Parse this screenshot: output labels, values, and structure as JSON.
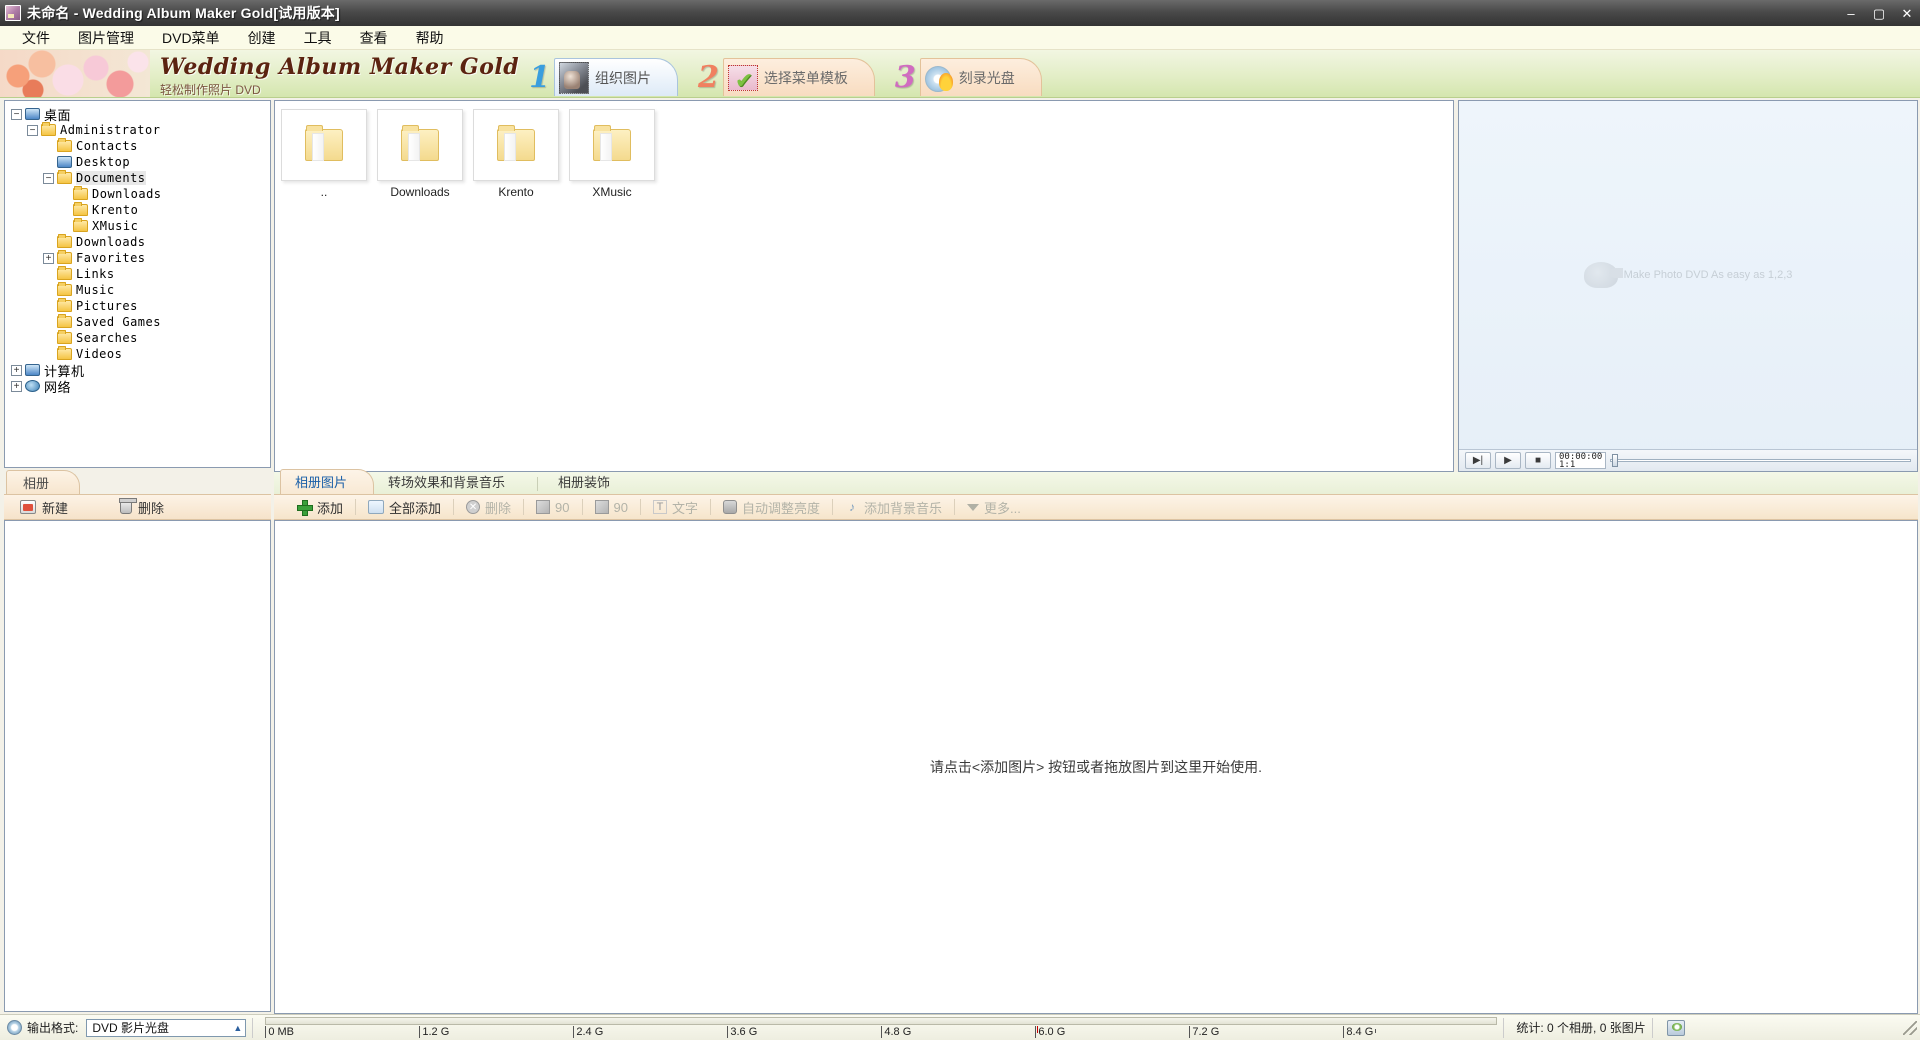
{
  "window": {
    "title": "未命名 - Wedding Album Maker Gold[试用版本]",
    "minimize": "–",
    "maximize": "▢",
    "close": "✕"
  },
  "menu": {
    "items": [
      {
        "label": "文件"
      },
      {
        "label": "图片管理"
      },
      {
        "label": "DVD菜单"
      },
      {
        "label": "创建"
      },
      {
        "label": "工具"
      },
      {
        "label": "查看"
      },
      {
        "label": "帮助"
      }
    ]
  },
  "banner": {
    "brand_title": "Wedding Album Maker Gold",
    "brand_sub": "轻松制作照片 DVD",
    "steps": [
      {
        "num": "1",
        "label": "组织图片",
        "icon": "photo-icon",
        "active": true
      },
      {
        "num": "2",
        "label": "选择菜单模板",
        "icon": "template-icon",
        "active": false
      },
      {
        "num": "3",
        "label": "刻录光盘",
        "icon": "disc-burn-icon",
        "active": false
      }
    ]
  },
  "tree": {
    "nodes": [
      {
        "label": "桌面",
        "depth": 0,
        "expander": "−",
        "icon": "desktop-icon",
        "cn": true,
        "selected": false
      },
      {
        "label": "Administrator",
        "depth": 1,
        "expander": "−",
        "icon": "folder-icon",
        "cn": false,
        "selected": false
      },
      {
        "label": "Contacts",
        "depth": 2,
        "expander": "",
        "icon": "folder-icon",
        "cn": false,
        "selected": false
      },
      {
        "label": "Desktop",
        "depth": 2,
        "expander": "",
        "icon": "desktop-icon",
        "cn": false,
        "selected": false
      },
      {
        "label": "Documents",
        "depth": 2,
        "expander": "−",
        "icon": "folder-icon",
        "cn": false,
        "selected": true
      },
      {
        "label": "Downloads",
        "depth": 3,
        "expander": "",
        "icon": "folder-icon",
        "cn": false,
        "selected": false
      },
      {
        "label": "Krento",
        "depth": 3,
        "expander": "",
        "icon": "folder-icon",
        "cn": false,
        "selected": false
      },
      {
        "label": "XMusic",
        "depth": 3,
        "expander": "",
        "icon": "folder-icon",
        "cn": false,
        "selected": false
      },
      {
        "label": "Downloads",
        "depth": 2,
        "expander": "",
        "icon": "folder-icon",
        "cn": false,
        "selected": false
      },
      {
        "label": "Favorites",
        "depth": 2,
        "expander": "+",
        "icon": "folder-icon",
        "cn": false,
        "selected": false
      },
      {
        "label": "Links",
        "depth": 2,
        "expander": "",
        "icon": "folder-icon",
        "cn": false,
        "selected": false
      },
      {
        "label": "Music",
        "depth": 2,
        "expander": "",
        "icon": "folder-icon",
        "cn": false,
        "selected": false
      },
      {
        "label": "Pictures",
        "depth": 2,
        "expander": "",
        "icon": "folder-icon",
        "cn": false,
        "selected": false
      },
      {
        "label": "Saved Games",
        "depth": 2,
        "expander": "",
        "icon": "folder-icon",
        "cn": false,
        "selected": false
      },
      {
        "label": "Searches",
        "depth": 2,
        "expander": "",
        "icon": "folder-icon",
        "cn": false,
        "selected": false
      },
      {
        "label": "Videos",
        "depth": 2,
        "expander": "",
        "icon": "folder-icon",
        "cn": false,
        "selected": false
      },
      {
        "label": "计算机",
        "depth": 0,
        "expander": "+",
        "icon": "computer-icon",
        "cn": true,
        "selected": false
      },
      {
        "label": "网络",
        "depth": 0,
        "expander": "+",
        "icon": "network-icon",
        "cn": true,
        "selected": false
      }
    ]
  },
  "browser": {
    "folders": [
      {
        "name": ".."
      },
      {
        "name": "Downloads"
      },
      {
        "name": "Krento"
      },
      {
        "name": "XMusic"
      }
    ]
  },
  "preview": {
    "watermark": "Make Photo DVD As easy as 1,2,3",
    "controls": {
      "prev_label": "▶|",
      "play_label": "▶",
      "stop_label": "■",
      "time_top": "00:00:00",
      "time_bottom": "1:1"
    }
  },
  "album_panel": {
    "tab_label": "相册",
    "new_label": "新建",
    "delete_label": "删除"
  },
  "editor": {
    "tabs": [
      {
        "label": "相册图片",
        "active": true
      },
      {
        "label": "转场效果和背景音乐",
        "active": false
      },
      {
        "label": "相册装饰",
        "active": false
      }
    ],
    "toolbar": [
      {
        "label": "添加",
        "icon": "plus-icon",
        "disabled": false
      },
      {
        "label": "全部添加",
        "icon": "add-all-icon",
        "disabled": false
      },
      {
        "label": "删除",
        "icon": "delete-icon",
        "disabled": true
      },
      {
        "label": "90",
        "icon": "rotate-left-icon",
        "disabled": true
      },
      {
        "label": "90",
        "icon": "rotate-right-icon",
        "disabled": true
      },
      {
        "label": "文字",
        "icon": "text-icon",
        "disabled": true
      },
      {
        "label": "自动调整亮度",
        "icon": "brightness-icon",
        "disabled": true
      },
      {
        "label": "添加背景音乐",
        "icon": "music-note-icon",
        "disabled": true
      },
      {
        "label": "更多...",
        "icon": "chevron-down-icon",
        "disabled": true
      }
    ],
    "hint": "请点击<添加图片> 按钮或者拖放图片到这里开始使用."
  },
  "statusbar": {
    "output_label": "输出格式:",
    "output_value": "DVD 影片光盘",
    "capacity_ticks": [
      "0 MB",
      "1.2 G",
      "2.4 G",
      "3.6 G",
      "4.8 G",
      "6.0 G",
      "7.2 G",
      "8.4 G"
    ],
    "stats": "统计: 0 个相册, 0 张图片",
    "burn_icon": "burn-disc-icon"
  },
  "colors": {
    "accent_blue": "#1a5fa8",
    "banner_green": "#d4e6ae",
    "tab_cream": "#f8e9d4",
    "title_dark": "#333333"
  }
}
